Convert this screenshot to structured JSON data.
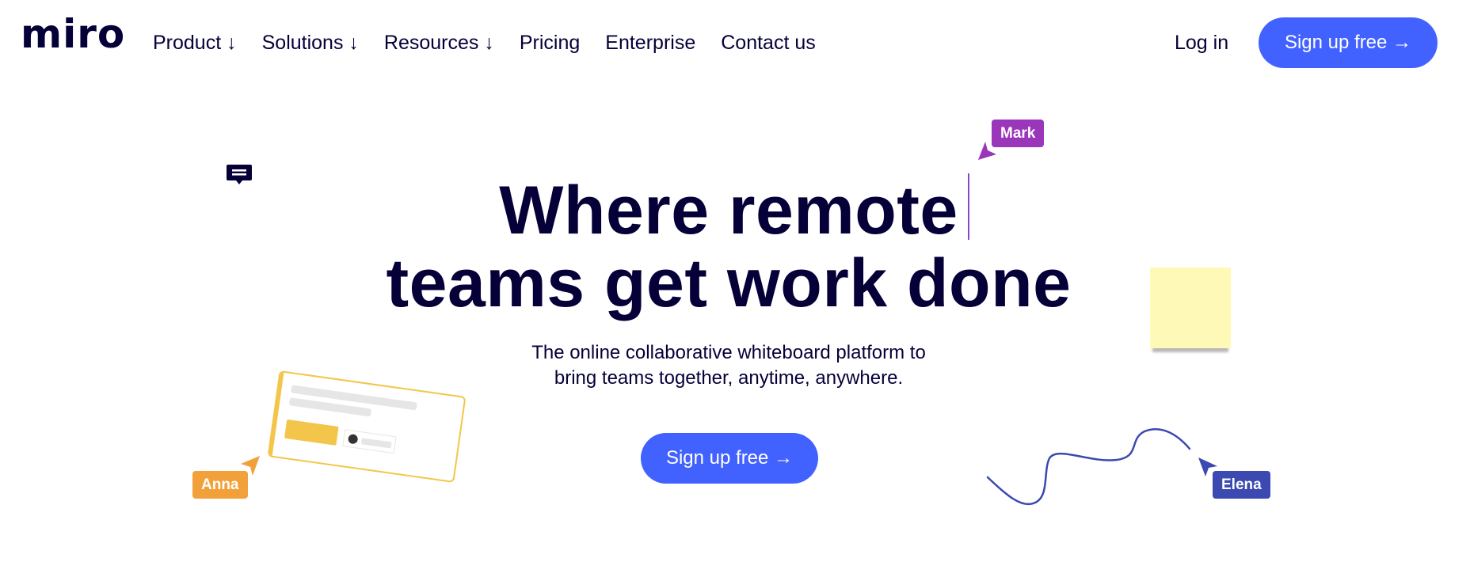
{
  "header": {
    "logo_text": "miro",
    "nav": [
      {
        "label": "Product ↓"
      },
      {
        "label": "Solutions ↓"
      },
      {
        "label": "Resources ↓"
      },
      {
        "label": "Pricing"
      },
      {
        "label": "Enterprise"
      },
      {
        "label": "Contact us"
      }
    ],
    "login_label": "Log in",
    "signup_label": "Sign up free →"
  },
  "hero": {
    "title_line1": "Where remote",
    "title_line2": "teams get work done",
    "subtitle_line1": "The online collaborative whiteboard platform to",
    "subtitle_line2": "bring teams together, anytime, anywhere.",
    "cta_label": "Sign up free →"
  },
  "cursors": {
    "mark": "Mark",
    "anna": "Anna",
    "elena": "Elena"
  },
  "colors": {
    "accent": "#4262ff",
    "text": "#050038",
    "mark": "#9a36b9",
    "anna": "#f2a13a",
    "elena": "#3b49b0",
    "sticky": "#fff9b8",
    "card_border": "#f3c64b"
  },
  "icons": {
    "comment": "comment-icon",
    "cursor_arrow": "cursor-arrow-icon"
  }
}
